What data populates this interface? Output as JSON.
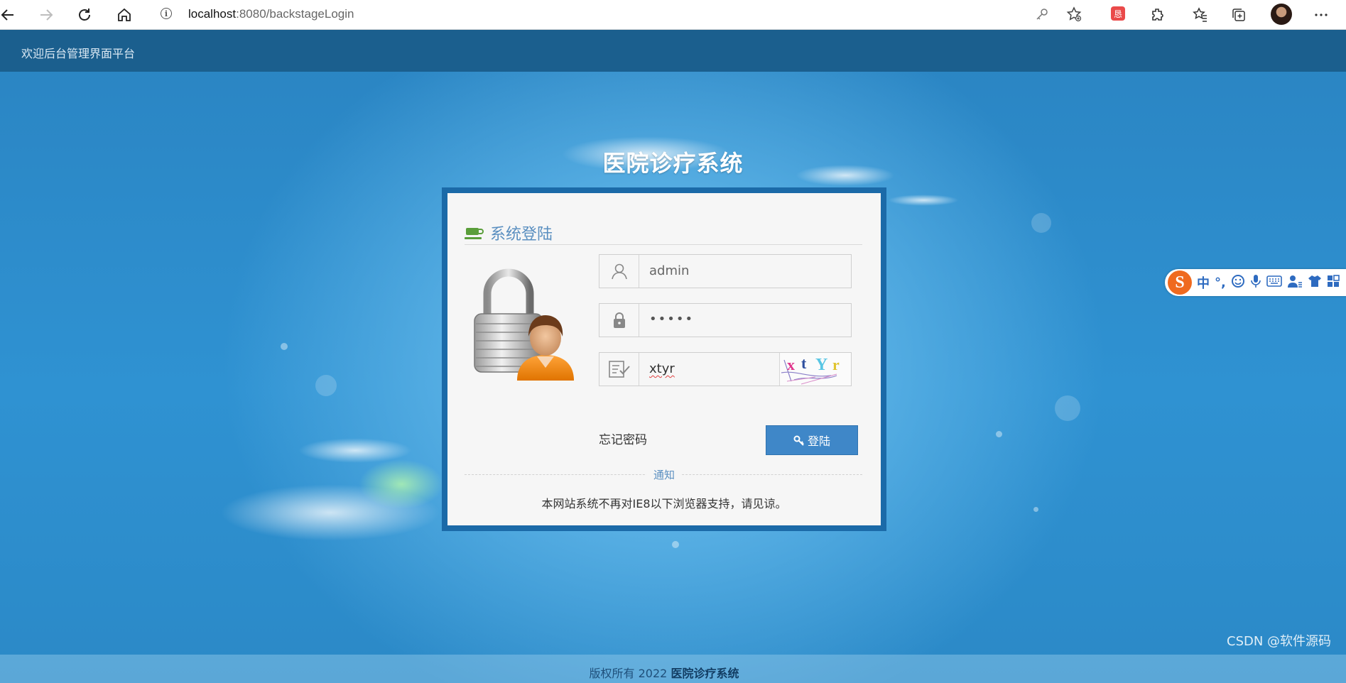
{
  "browser": {
    "url_host": "localhost",
    "url_path": ":8080/backstageLogin",
    "ext_badge": "恳"
  },
  "header": {
    "welcome": "欢迎后台管理界面平台"
  },
  "system_title": "医院诊疗系统",
  "login": {
    "title": "系统登陆",
    "username_value": "admin",
    "password_value": "•••••",
    "captcha_value": "xtyr",
    "captcha_image_text": "xtYr",
    "forgot_label": "忘记密码",
    "login_button": "登陆",
    "notice_label": "通知",
    "notice_text": "本网站系统不再对IE8以下浏览器支持，请见谅。"
  },
  "footer": {
    "copyright_prefix": "版权所有 2022 ",
    "copyright_system": "医院诊疗系统"
  },
  "watermark": "CSDN @软件源码",
  "ime": {
    "logo": "S",
    "mode": "中",
    "punct": "°,"
  },
  "colors": {
    "topbar": "#1b5f8e",
    "login_border": "#1b6aa8",
    "login_button": "#3f87c8",
    "accent_text": "#5a8fc0"
  }
}
